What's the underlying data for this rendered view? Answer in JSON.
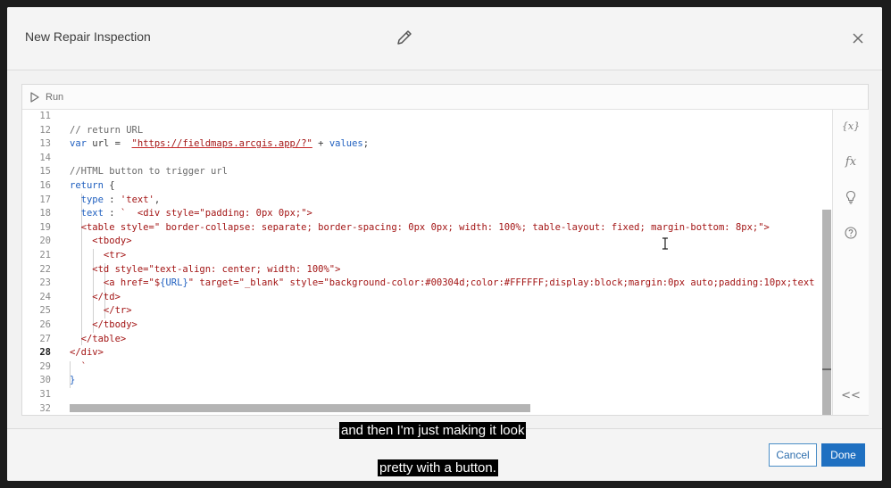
{
  "dialog": {
    "title": "New Repair Inspection"
  },
  "icons": {
    "edit": "pencil-icon",
    "close": "close-icon",
    "run": "play-icon",
    "cursor": "text-cursor-icon"
  },
  "toolbar": {
    "run_label": "Run"
  },
  "side_rail": {
    "variables_label": "{x}",
    "functions_label": "fx",
    "suggestions_icon": "lightbulb-icon",
    "help_icon": "help-icon",
    "collapse_label": "<<"
  },
  "editor": {
    "line_numbers": [
      "11",
      "12",
      "13",
      "14",
      "15",
      "16",
      "17",
      "18",
      "19",
      "20",
      "21",
      "22",
      "23",
      "24",
      "25",
      "26",
      "27",
      "28",
      "29",
      "30",
      "31",
      "32"
    ],
    "active_line": "28",
    "lines": {
      "l12": "// return URL",
      "l13_kw": "var",
      "l13_a": " url =  ",
      "l13_str": "\"https://fieldmaps.arcgis.app/?\"",
      "l13_b": " + ",
      "l13_c": "values",
      "l13_d": ";",
      "l15": "//HTML button to trigger url",
      "l16_kw": "return",
      "l16_b": " {",
      "l17_a": "  ",
      "l17_kw": "type",
      "l17_b": " : ",
      "l17_str": "'text'",
      "l17_c": ",",
      "l18_a": "  ",
      "l18_kw": "text",
      "l18_b": " : ",
      "l18_str": "`  <div style=\"padding: 0px 0px;\">",
      "l19": "  <table style=\" border-collapse: separate; border-spacing: 0px 0px; width: 100%; table-layout: fixed; margin-bottom: 8px;\">",
      "l20": "    <tbody>",
      "l21": "      <tr>",
      "l22": "    <td style=\"text-align: center; width: 100%\">",
      "l23_a": "      <a href=\"$",
      "l23_kw": "{URL}",
      "l23_b": "\" target=\"_blank\" style=\"background-color:#00304d;color:#FFFFFF;display:block;margin:0px auto;padding:10px;text",
      "l24": "    </td>",
      "l25": "      </tr>",
      "l26": "    </tbody>",
      "l27": "  </table>",
      "l28": "</div>",
      "l29": "  `",
      "l30": "}"
    }
  },
  "footer": {
    "cancel_label": "Cancel",
    "done_label": "Done"
  },
  "captions": {
    "line1": "and then I'm just making it look",
    "line2": "pretty with a button."
  },
  "colors": {
    "done_button": "#1f70c1",
    "cancel_border": "#4b8ec7",
    "keyword": "#1f5fbf",
    "string": "#a31515"
  }
}
